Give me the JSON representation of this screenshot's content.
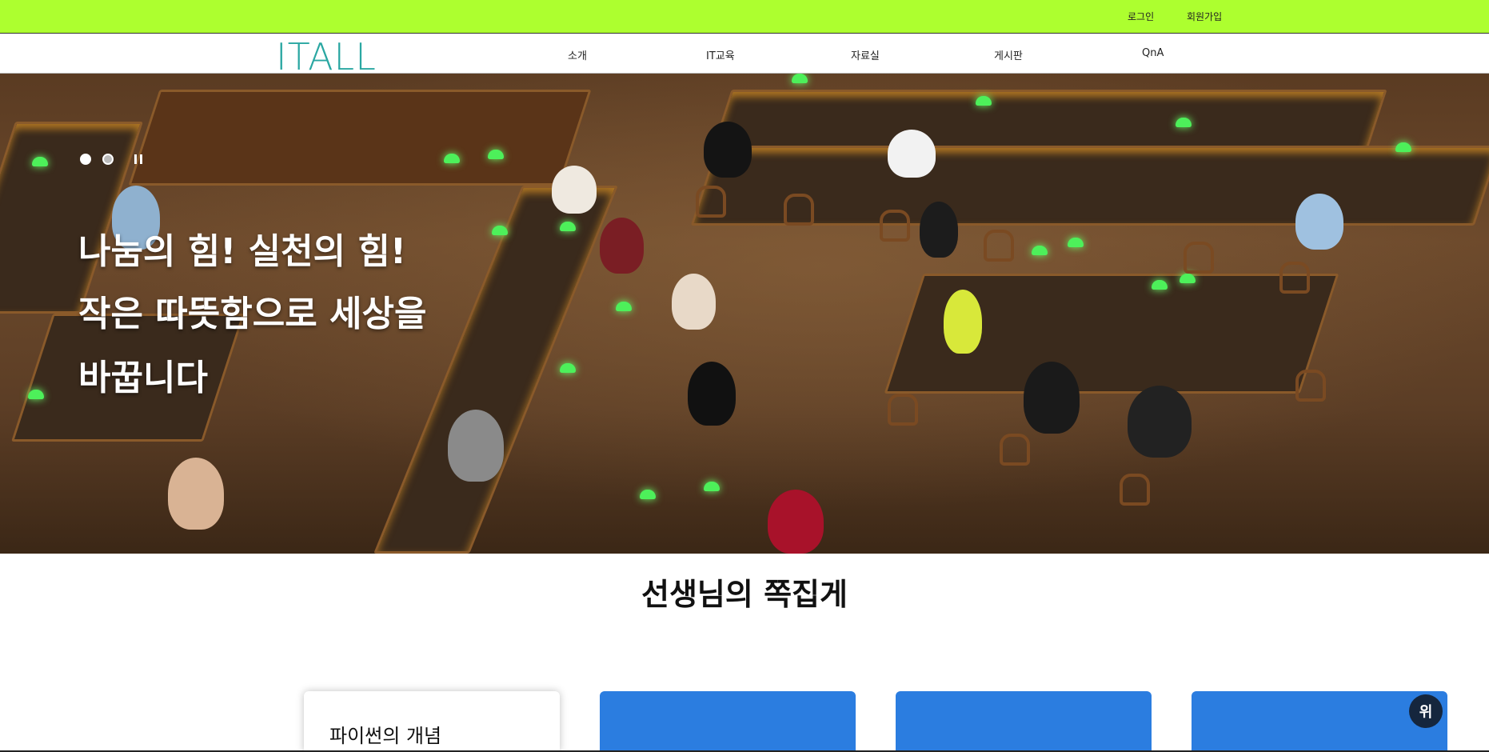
{
  "topbar": {
    "login": "로그인",
    "signup": "회원가입",
    "bg_color": "#adff2f"
  },
  "navbar": {
    "logo": "ITALL",
    "logo_color": "#2aa7a2",
    "items": [
      "소개",
      "IT교육",
      "자료실",
      "게시판",
      "QnA"
    ]
  },
  "hero": {
    "slider": {
      "slides": 2,
      "active": 1,
      "pause_icon": "pause-icon"
    },
    "lines": [
      "나눔의 힘! 실천의 힘!",
      "작은 따뜻함으로 세상을",
      "바꿉니다"
    ]
  },
  "section": {
    "title": "선생님의 쪽집게"
  },
  "cards": [
    {
      "title": "파이썬의 개념",
      "style": "white"
    },
    {
      "title": "",
      "style": "blue"
    },
    {
      "title": "",
      "style": "blue"
    },
    {
      "title": "",
      "style": "blue"
    }
  ],
  "top_button": {
    "label": "위"
  },
  "colors": {
    "card_blue": "#2b7de0",
    "top_button": "#15263d"
  }
}
